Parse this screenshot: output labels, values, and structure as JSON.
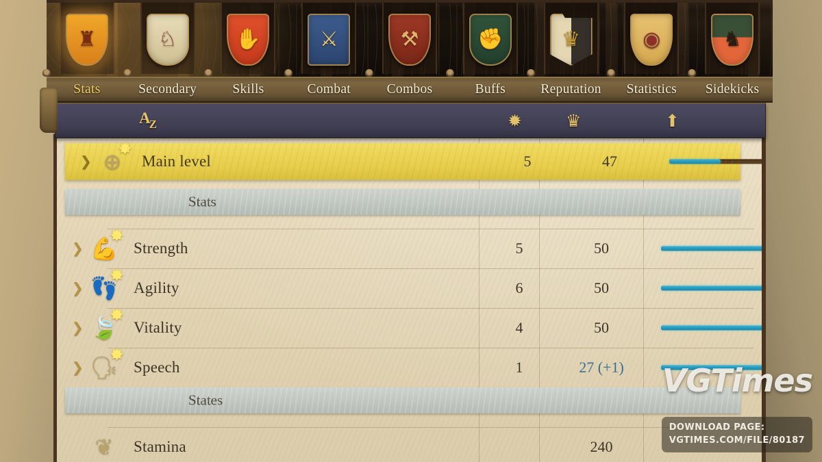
{
  "tabs": [
    {
      "label": "Stats",
      "active": true,
      "icon": "shield-knight-orange",
      "emoji": "♜",
      "shape": "pointed",
      "bg": "linear-gradient(180deg,#f0a628,#d8801a)",
      "fg": "#7a2b10"
    },
    {
      "label": "Secondary",
      "active": false,
      "icon": "shield-archer-cream",
      "emoji": "♘",
      "shape": "round",
      "bg": "linear-gradient(180deg,#e8dcb8,#cfc093)",
      "fg": "#8c2f26"
    },
    {
      "label": "Skills",
      "active": false,
      "icon": "shield-hands-red",
      "emoji": "✋",
      "shape": "pointed",
      "bg": "linear-gradient(180deg,#e2502c,#c43a1c)",
      "fg": "#7d1c10"
    },
    {
      "label": "Combat",
      "active": false,
      "icon": "shield-sword-blue",
      "emoji": "⚔",
      "shape": "square",
      "bg": "linear-gradient(180deg,#3c5c8e,#2c4570)",
      "fg": "#e9c46a"
    },
    {
      "label": "Combos",
      "active": false,
      "icon": "shield-arm-dark-red",
      "emoji": "⚒",
      "shape": "pointed",
      "bg": "linear-gradient(180deg,#9e3826,#7a2718)",
      "fg": "#e0b468"
    },
    {
      "label": "Buffs",
      "active": false,
      "icon": "shield-fist-green",
      "emoji": "✊",
      "shape": "round",
      "bg": "linear-gradient(180deg,#31543c,#22402c)",
      "fg": "#efe3c2"
    },
    {
      "label": "Reputation",
      "active": false,
      "icon": "shield-crown-noose",
      "emoji": "♛",
      "shape": "notch",
      "bg": "linear-gradient(90deg,#e4d7b2 50%,#35302a 50%)",
      "fg": "#c89a32"
    },
    {
      "label": "Statistics",
      "active": false,
      "icon": "shield-target",
      "emoji": "◉",
      "shape": "pointed",
      "bg": "linear-gradient(180deg,#e8c271,#d4a84e)",
      "fg": "#8e2f2a"
    },
    {
      "label": "Sidekicks",
      "active": false,
      "icon": "shield-beast-orange",
      "emoji": "♞",
      "shape": "pointed",
      "bg": "linear-gradient(180deg,#3a5036 45%,#e2663a 45%)",
      "fg": "#2b1c12"
    }
  ],
  "sortbar": {
    "alpha_sort_a": "A",
    "alpha_sort_z": "Z",
    "star_icon": "✹",
    "crown_icon": "♛",
    "arrow_icon": "⬆"
  },
  "rows": [
    {
      "kind": "main",
      "name": "Main level",
      "icon": "orb-cross-icon",
      "glyph": "⊕",
      "col1": "5",
      "col2": "47",
      "bar_percent": 37,
      "buffed": false,
      "expandable": true
    },
    {
      "kind": "section",
      "name": "Stats"
    },
    {
      "kind": "stat",
      "name": "Strength",
      "icon": "flexed-bicep-icon",
      "glyph": "💪",
      "col1": "5",
      "col2": "50",
      "bar_percent": 100,
      "buffed": false,
      "expandable": true
    },
    {
      "kind": "stat",
      "name": "Agility",
      "icon": "winged-foot-icon",
      "glyph": "👣",
      "col1": "6",
      "col2": "50",
      "bar_percent": 100,
      "buffed": false,
      "expandable": true
    },
    {
      "kind": "stat",
      "name": "Vitality",
      "icon": "leaf-icon",
      "glyph": "🍃",
      "col1": "4",
      "col2": "50",
      "bar_percent": 100,
      "buffed": false,
      "expandable": true
    },
    {
      "kind": "stat",
      "name": "Speech",
      "icon": "speaking-mouth-icon",
      "glyph": "🗣",
      "col1": "1",
      "col2": "27 (+1)",
      "bar_percent": 90,
      "buffed": true,
      "expandable": true
    },
    {
      "kind": "section",
      "name": "States"
    },
    {
      "kind": "stat",
      "name": "Stamina",
      "icon": "wreath-heart-icon",
      "glyph": "❦",
      "col1": "",
      "col2": "240",
      "bar_percent": 0,
      "buffed": false,
      "expandable": false
    }
  ],
  "watermark": {
    "logo": "VGTimes",
    "line1": "DOWNLOAD PAGE:",
    "line2": "VGTIMES.COM/FILE/80187"
  },
  "colors": {
    "accent_gold": "#e9c368",
    "bar_fill": "#2499bd",
    "bar_track": "#6d4f2c",
    "buff_text": "#3b6f93",
    "main_row": "#ecd556",
    "section_band": "#c2c8c2"
  }
}
